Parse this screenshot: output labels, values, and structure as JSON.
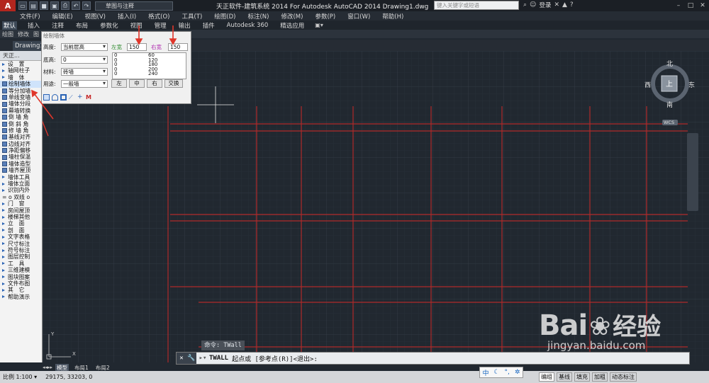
{
  "titlebar": {
    "app_logo": "A",
    "workspace": "草图与注释",
    "title": "天正软件-建筑系统 2014  For Autodesk AutoCAD 2014   Drawing1.dwg",
    "search_placeholder": "键入关键字或短语",
    "login": "登录"
  },
  "menu": [
    "文件(F)",
    "编辑(E)",
    "视图(V)",
    "插入(I)",
    "格式(O)",
    "工具(T)",
    "绘图(D)",
    "标注(N)",
    "修改(M)",
    "参数(P)",
    "窗口(W)",
    "帮助(H)"
  ],
  "ribbon_tabs": [
    "默认",
    "插入",
    "注释",
    "布局",
    "参数化",
    "视图",
    "管理",
    "输出",
    "插件",
    "Autodesk 360",
    "精选应用"
  ],
  "panel_labels": [
    "绘图",
    "修改",
    "图"
  ],
  "doc_tab": "Drawing1",
  "sidebar": {
    "header": "天正...",
    "items": [
      {
        "label": "设　置",
        "type": "tri"
      },
      {
        "label": "轴网柱子",
        "type": "tri"
      },
      {
        "label": "墙　体",
        "type": "tri"
      },
      {
        "label": "绘制墙体",
        "type": "ico",
        "selected": true
      },
      {
        "label": "等分加墙",
        "type": "ico"
      },
      {
        "label": "单线变墙",
        "type": "ico"
      },
      {
        "label": "墙体分段",
        "type": "ico"
      },
      {
        "label": "幕墙转换",
        "type": "ico"
      },
      {
        "label": "倒 墙 角",
        "type": "ico"
      },
      {
        "label": "倒 斜 角",
        "type": "ico"
      },
      {
        "label": "修 墙 角",
        "type": "ico"
      },
      {
        "label": "基线对齐",
        "type": "ico"
      },
      {
        "label": "边线对齐",
        "type": "ico"
      },
      {
        "label": "净距偏移",
        "type": "ico"
      },
      {
        "label": "墙柱保温",
        "type": "ico"
      },
      {
        "label": "墙体造型",
        "type": "ico"
      },
      {
        "label": "墙齐屋顶",
        "type": "ico"
      },
      {
        "label": "墙体工具",
        "type": "tri"
      },
      {
        "label": "墙体立面",
        "type": "tri"
      },
      {
        "label": "识别内外",
        "type": "tri"
      },
      {
        "label": "= o 双线 o",
        "type": "none"
      },
      {
        "label": "门　窗",
        "type": "tri"
      },
      {
        "label": "房间屋顶",
        "type": "tri"
      },
      {
        "label": "楼梯其他",
        "type": "tri"
      },
      {
        "label": "立　面",
        "type": "tri"
      },
      {
        "label": "剖　面",
        "type": "tri"
      },
      {
        "label": "文字表格",
        "type": "tri"
      },
      {
        "label": "尺寸标注",
        "type": "tri"
      },
      {
        "label": "符号标注",
        "type": "tri"
      },
      {
        "label": "图层控制",
        "type": "tri"
      },
      {
        "label": "工　具",
        "type": "tri"
      },
      {
        "label": "三维建模",
        "type": "tri"
      },
      {
        "label": "图块图案",
        "type": "tri"
      },
      {
        "label": "文件布图",
        "type": "tri"
      },
      {
        "label": "其　它",
        "type": "tri"
      },
      {
        "label": "帮助演示",
        "type": "tri"
      }
    ]
  },
  "dialog": {
    "title": "绘制墙体",
    "height_label": "高度:",
    "height_value": "当前层高",
    "base_label": "底高:",
    "base_value": "0",
    "material_label": "材料:",
    "material_value": "砖墙",
    "usage_label": "用途:",
    "usage_value": "一般墙",
    "left_width_label": "左宽",
    "left_width_value": "150",
    "right_width_label": "右宽",
    "right_width_value": "150",
    "width_list": [
      [
        "0",
        "60"
      ],
      [
        "0",
        "120"
      ],
      [
        "0",
        "180"
      ],
      [
        "0",
        "200"
      ],
      [
        "0",
        "240"
      ]
    ],
    "btn_left": "左",
    "btn_center": "中",
    "btn_right": "右",
    "btn_swap": "交换",
    "tool_m": "M"
  },
  "compass": {
    "north": "北",
    "south": "南",
    "east": "东",
    "west": "西",
    "top": "上",
    "wcs": "WCS"
  },
  "command": {
    "history": "命令: TWall",
    "prompt_cmd": "TWALL",
    "prompt_text": "起点或 [参考点(R)]<退出>:"
  },
  "layout_tabs": [
    "模型",
    "布局1",
    "布局2"
  ],
  "status": {
    "coords": "29175, 33203, 0",
    "ime": "中",
    "right_items": [
      "编组",
      "基线",
      "填充",
      "加粗",
      "动态标注"
    ]
  },
  "watermark": {
    "brand": "Bai",
    "suffix": "经验",
    "url": "jingyan.baidu.com"
  },
  "colors": {
    "grid_line": "#b02a2a",
    "accent_arrow": "#e0362b",
    "canvas_bg": "#212830"
  }
}
